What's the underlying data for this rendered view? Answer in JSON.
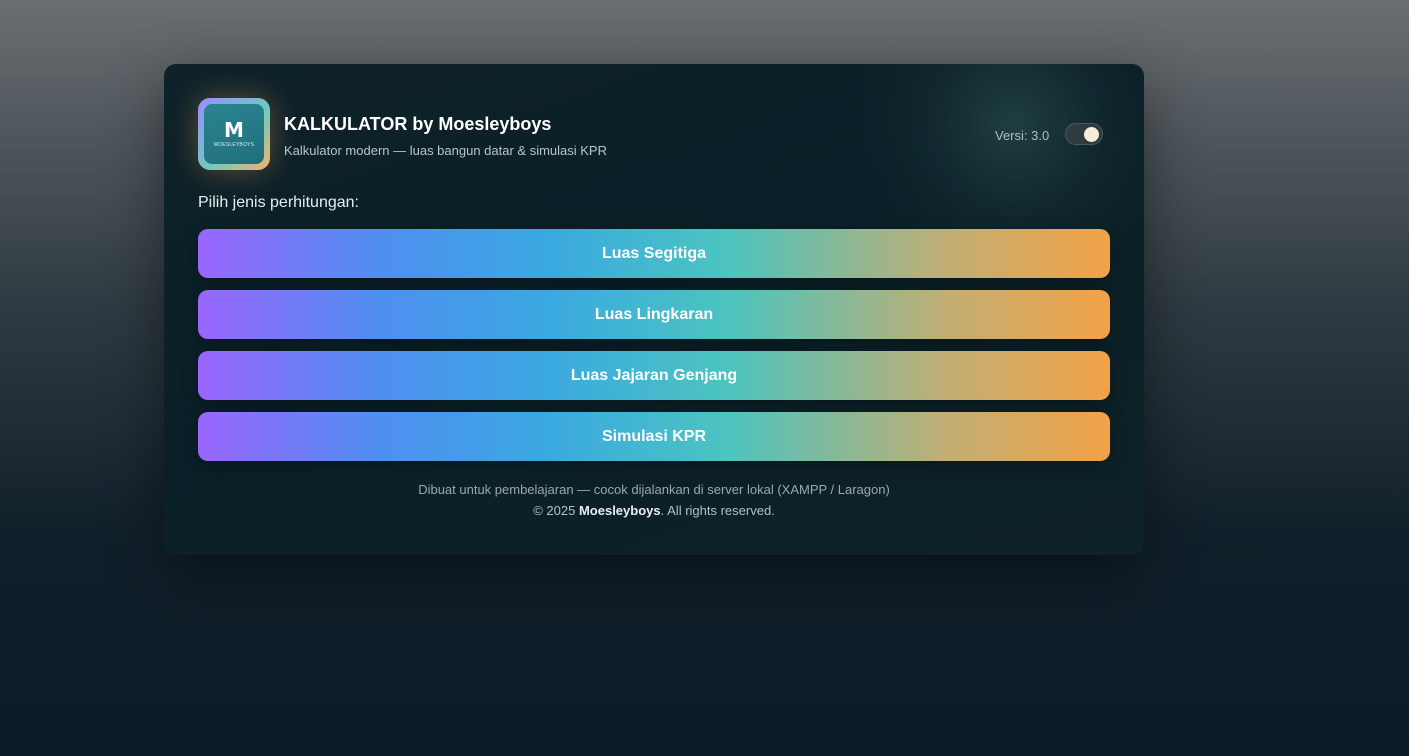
{
  "header": {
    "logo_mark": "M",
    "logo_text": "MOESLEYBOYS",
    "title": "KALKULATOR by Moesleyboys",
    "subtitle": "Kalkulator modern — luas bangun datar & simulasi KPR",
    "version": "Versi: 3.0"
  },
  "theme_toggle": {
    "state": "on"
  },
  "prompt": "Pilih jenis perhitungan:",
  "options": [
    {
      "label": "Luas Segitiga"
    },
    {
      "label": "Luas Lingkaran"
    },
    {
      "label": "Luas Jajaran Genjang"
    },
    {
      "label": "Simulasi KPR"
    }
  ],
  "footer": {
    "note": "Dibuat untuk pembelajaran — cocok dijalankan di server lokal (XAMPP / Laragon)",
    "copyright_prefix": "© 2025",
    "brand": "Moesleyboys",
    "copyright_suffix": ". All rights reserved."
  },
  "colors": {
    "gradient_start": "#9a66ff",
    "gradient_mid": "#4cc4bf",
    "gradient_end": "#f3a246"
  }
}
